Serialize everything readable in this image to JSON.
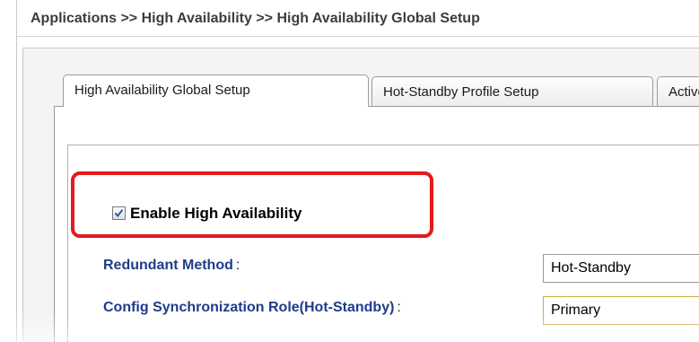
{
  "breadcrumb": "Applications >> High Availability >> High Availability Global Setup",
  "tabs": [
    {
      "label": "High Availability Global Setup",
      "active": true
    },
    {
      "label": "Hot-Standby Profile Setup",
      "active": false
    },
    {
      "label": "Active-Active Profile Setup",
      "active": false
    }
  ],
  "enable_ha": {
    "label": "Enable High Availability",
    "checked": true
  },
  "fields": {
    "redundant_method": {
      "label": "Redundant Method",
      "value": "Hot-Standby"
    },
    "config_sync_role": {
      "label": "Config Synchronization Role(Hot-Standby)",
      "value": "Primary"
    }
  },
  "colors": {
    "highlight": "#e21b1b",
    "field_label": "#1e3c8a"
  }
}
